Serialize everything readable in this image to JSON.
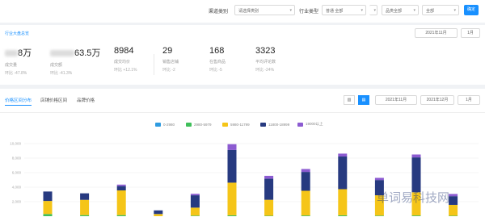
{
  "filters": {
    "label1": "渠道类别",
    "select1": "请选择类别",
    "select2": "",
    "label2": "行业类型",
    "select3": "普通 全部",
    "select4": "",
    "select5": "品类全部",
    "select6": "全部",
    "confirm": "确定"
  },
  "summary": {
    "breadcrumb": "行业大盘总览",
    "date_range": "2021年11月",
    "date_btn": "1月",
    "stats": [
      {
        "value": "8万",
        "label": "成交量",
        "compare": "环比 -47.8%"
      },
      {
        "value": "63.5万",
        "label": "成交额",
        "compare": "环比 -41.3%"
      },
      {
        "value": "8984",
        "label": "成交均价",
        "compare": "环比 +12.1%"
      },
      {
        "value": "29",
        "label": "销售店铺",
        "compare": "环比 -2"
      },
      {
        "value": "168",
        "label": "在售商品",
        "compare": "环比 -5"
      },
      {
        "value": "3323",
        "label": "平均评论数",
        "compare": "环比 -24%"
      }
    ]
  },
  "panel": {
    "tabs": [
      "价格区间分布",
      "店铺价格区间",
      "品牌价格"
    ],
    "toggle_chart": "▥",
    "toggle_table": "▤",
    "period_1": "2021年11月",
    "period_2": "2021年12月",
    "period_3": "1月"
  },
  "chart_data": {
    "type": "bar",
    "stacked": true,
    "series": [
      {
        "name": "0-2980",
        "color": "#2f9be0",
        "values": [
          0,
          0,
          0,
          0,
          0,
          0,
          0,
          0,
          0,
          0,
          0,
          0
        ]
      },
      {
        "name": "2980-5979",
        "color": "#3fbf5a",
        "values": [
          300,
          150,
          150,
          0,
          80,
          120,
          60,
          100,
          120,
          80,
          100,
          60
        ]
      },
      {
        "name": "5980-11799",
        "color": "#f5c518",
        "values": [
          1800,
          2100,
          3400,
          300,
          1100,
          4500,
          2200,
          3400,
          3600,
          2800,
          3200,
          1500
        ]
      },
      {
        "name": "11800-18999",
        "color": "#273a80",
        "values": [
          1300,
          900,
          600,
          500,
          1700,
          4500,
          2900,
          2600,
          4500,
          2100,
          4800,
          1200
        ]
      },
      {
        "name": "19000以上",
        "color": "#8c5bd1",
        "values": [
          0,
          0,
          200,
          0,
          200,
          800,
          400,
          400,
          400,
          300,
          400,
          300
        ]
      }
    ],
    "yticks": [
      "10,000",
      "8,000",
      "6,000",
      "4,000",
      "2,000"
    ],
    "ylim": [
      0,
      10000
    ]
  },
  "watermark": "单词易科技网"
}
